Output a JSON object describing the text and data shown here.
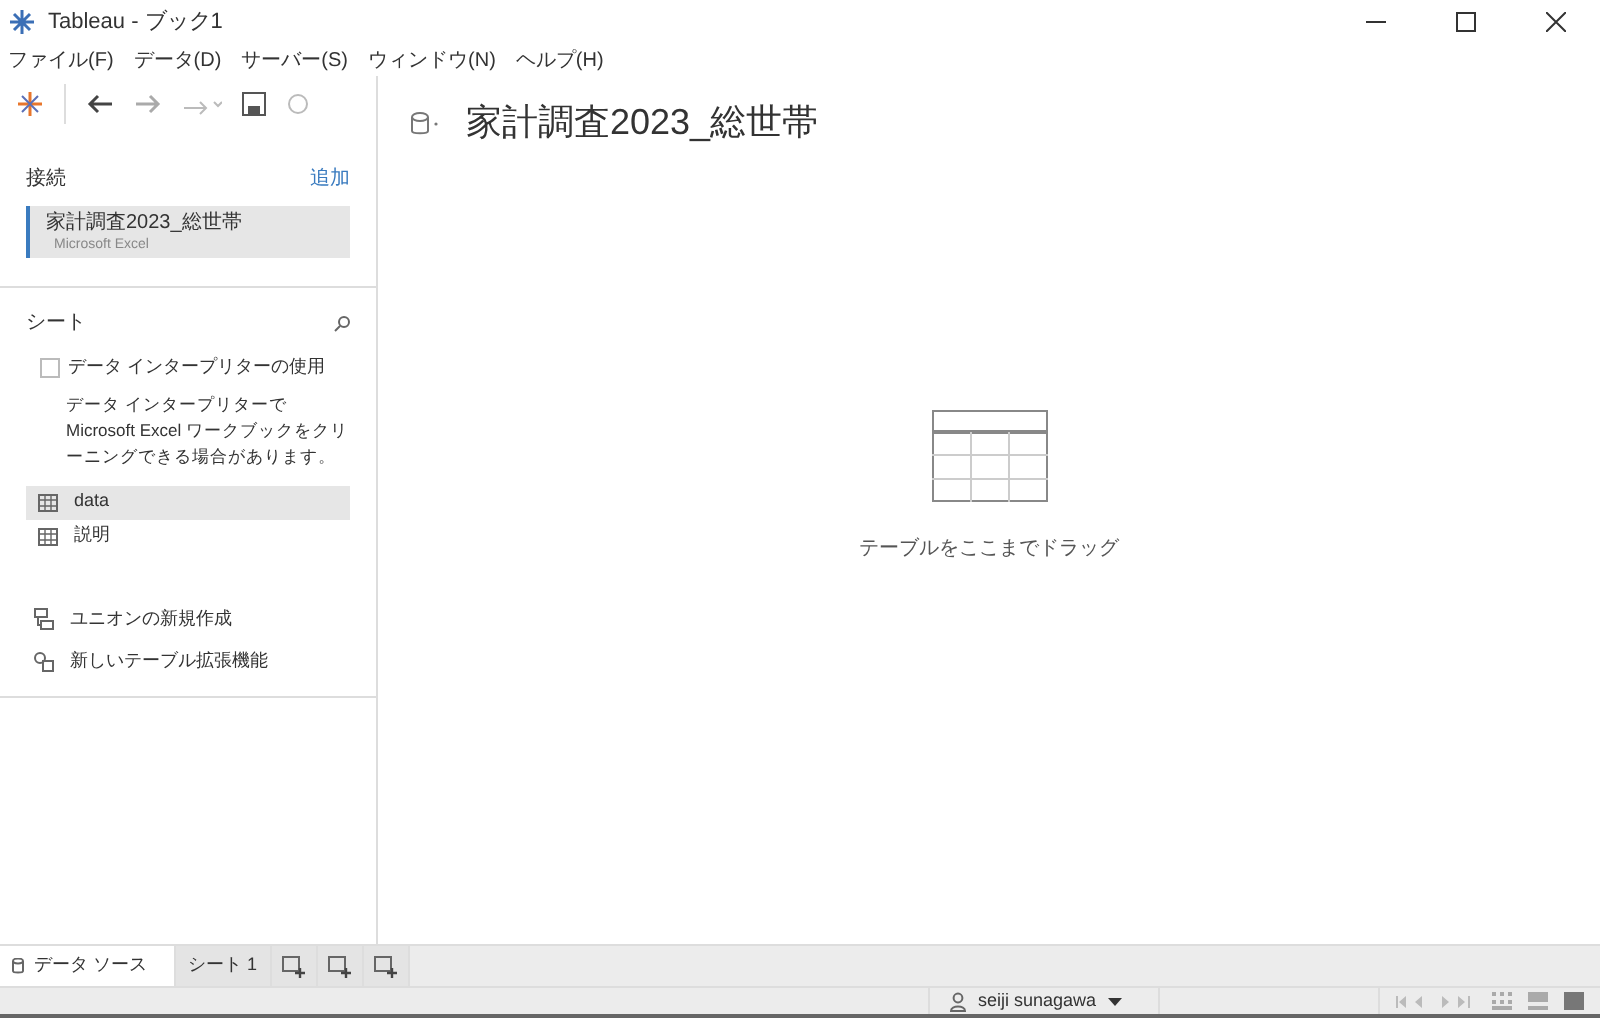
{
  "window": {
    "title": "Tableau - ブック1"
  },
  "menu": [
    "ファイル(F)",
    "データ(D)",
    "サーバー(S)",
    "ウィンドウ(N)",
    "ヘルプ(H)"
  ],
  "connections": {
    "label": "接続",
    "add": "追加",
    "items": [
      {
        "name": "家計調査2023_総世帯",
        "type": "Microsoft Excel",
        "selected": true
      }
    ]
  },
  "sheets": {
    "label": "シート",
    "interpreter": {
      "label": "データ インタープリターの使用",
      "checked": false
    },
    "description": "データ インタープリターで Microsoft Excel ワークブックをクリーニングできる場合があります。",
    "items": [
      {
        "name": "data",
        "selected": true
      },
      {
        "name": "説明",
        "selected": false
      }
    ]
  },
  "actions": [
    {
      "kind": "union",
      "label": "ユニオンの新規作成"
    },
    {
      "kind": "extension",
      "label": "新しいテーブル拡張機能"
    }
  ],
  "main": {
    "title": "家計調査2023_総世帯",
    "drop_hint": "テーブルをここまでドラッグ"
  },
  "tabs": [
    {
      "label": "データ ソース",
      "kind": "datasource",
      "selected": true
    },
    {
      "label": "シート 1",
      "kind": "sheet",
      "selected": false
    }
  ],
  "status": {
    "user": "seiji sunagawa"
  }
}
